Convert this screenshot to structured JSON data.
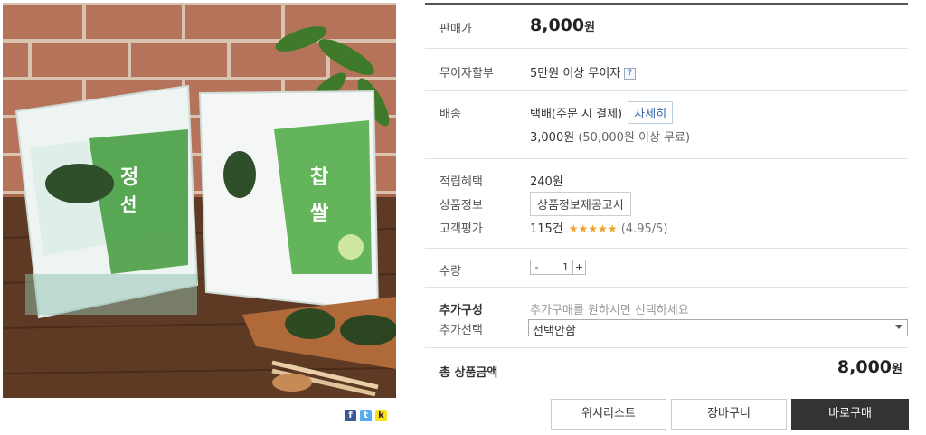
{
  "price": {
    "label": "판매가",
    "amount": "8,000",
    "unit": "원"
  },
  "installment": {
    "label": "무이자할부",
    "text": "5만원 이상 무이자",
    "help": "?"
  },
  "shipping": {
    "label": "배송",
    "method": "택배(주문 시 결제)",
    "detail_button": "자세히",
    "fee": "3,000원",
    "fee_note": "(50,000원 이상 무료)"
  },
  "points": {
    "label": "적립혜택",
    "value": "240원"
  },
  "product_info": {
    "label": "상품정보",
    "button": "상품정보제공고시"
  },
  "review": {
    "label": "고객평가",
    "count": "115건",
    "stars": "★★★★★",
    "score": "(4.95/5)"
  },
  "quantity": {
    "label": "수량",
    "minus": "-",
    "value": "1",
    "plus": "+"
  },
  "addon": {
    "label": "추가구성",
    "placeholder": "추가구매를 원하시면 선택하세요",
    "select_label": "추가선택",
    "selected": "선택안함"
  },
  "total": {
    "label": "총 상품금액",
    "amount": "8,000",
    "unit": "원"
  },
  "buttons": {
    "wishlist": "위시리스트",
    "cart": "장바구니",
    "buy": "바로구매"
  },
  "share": {
    "facebook": "f",
    "twitter": "t",
    "kakao": "k"
  }
}
